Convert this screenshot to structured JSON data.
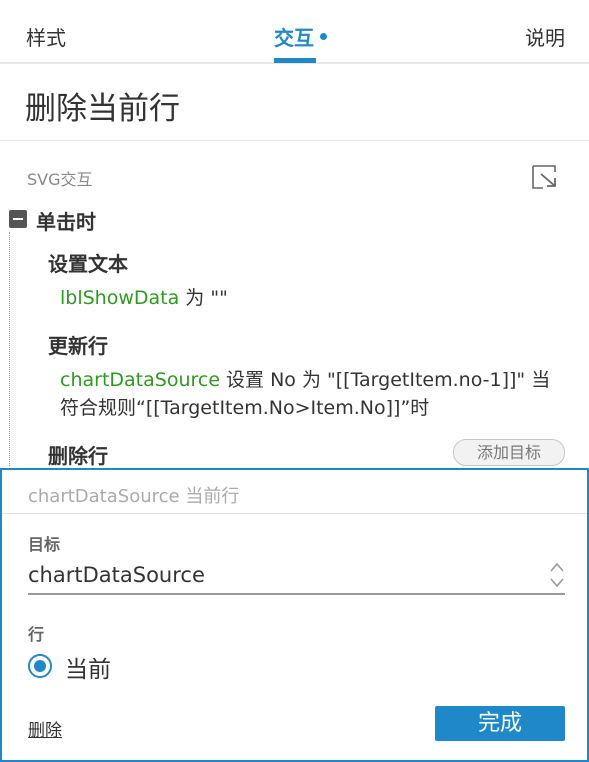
{
  "tabs": [
    {
      "label": "样式"
    },
    {
      "label": "交互"
    },
    {
      "label": "说明"
    }
  ],
  "active_tab": "交互",
  "accent_color": "#1e88c8",
  "title": "删除当前行",
  "section": {
    "label": "SVG交互",
    "collapse_icon": "collapse-arrow-icon"
  },
  "event": {
    "label": "单击时",
    "toggle_icon": "minus-icon"
  },
  "actions": [
    {
      "title": "设置文本",
      "target": "lblShowData",
      "detail": " 为 \"\""
    },
    {
      "title": "更新行",
      "target": "chartDataSource",
      "detail": " 设置 No 为 \"[[TargetItem.no-1]]\" 当符合规则“[[TargetItem.No>Item.No]]”时"
    },
    {
      "title": "删除行"
    }
  ],
  "add_target_label": "添加目标",
  "editor": {
    "header": "chartDataSource 当前行",
    "target_label": "目标",
    "target_value": "chartDataSource",
    "row_label": "行",
    "row_option": "当前",
    "delete_label": "删除",
    "done_label": "完成"
  }
}
